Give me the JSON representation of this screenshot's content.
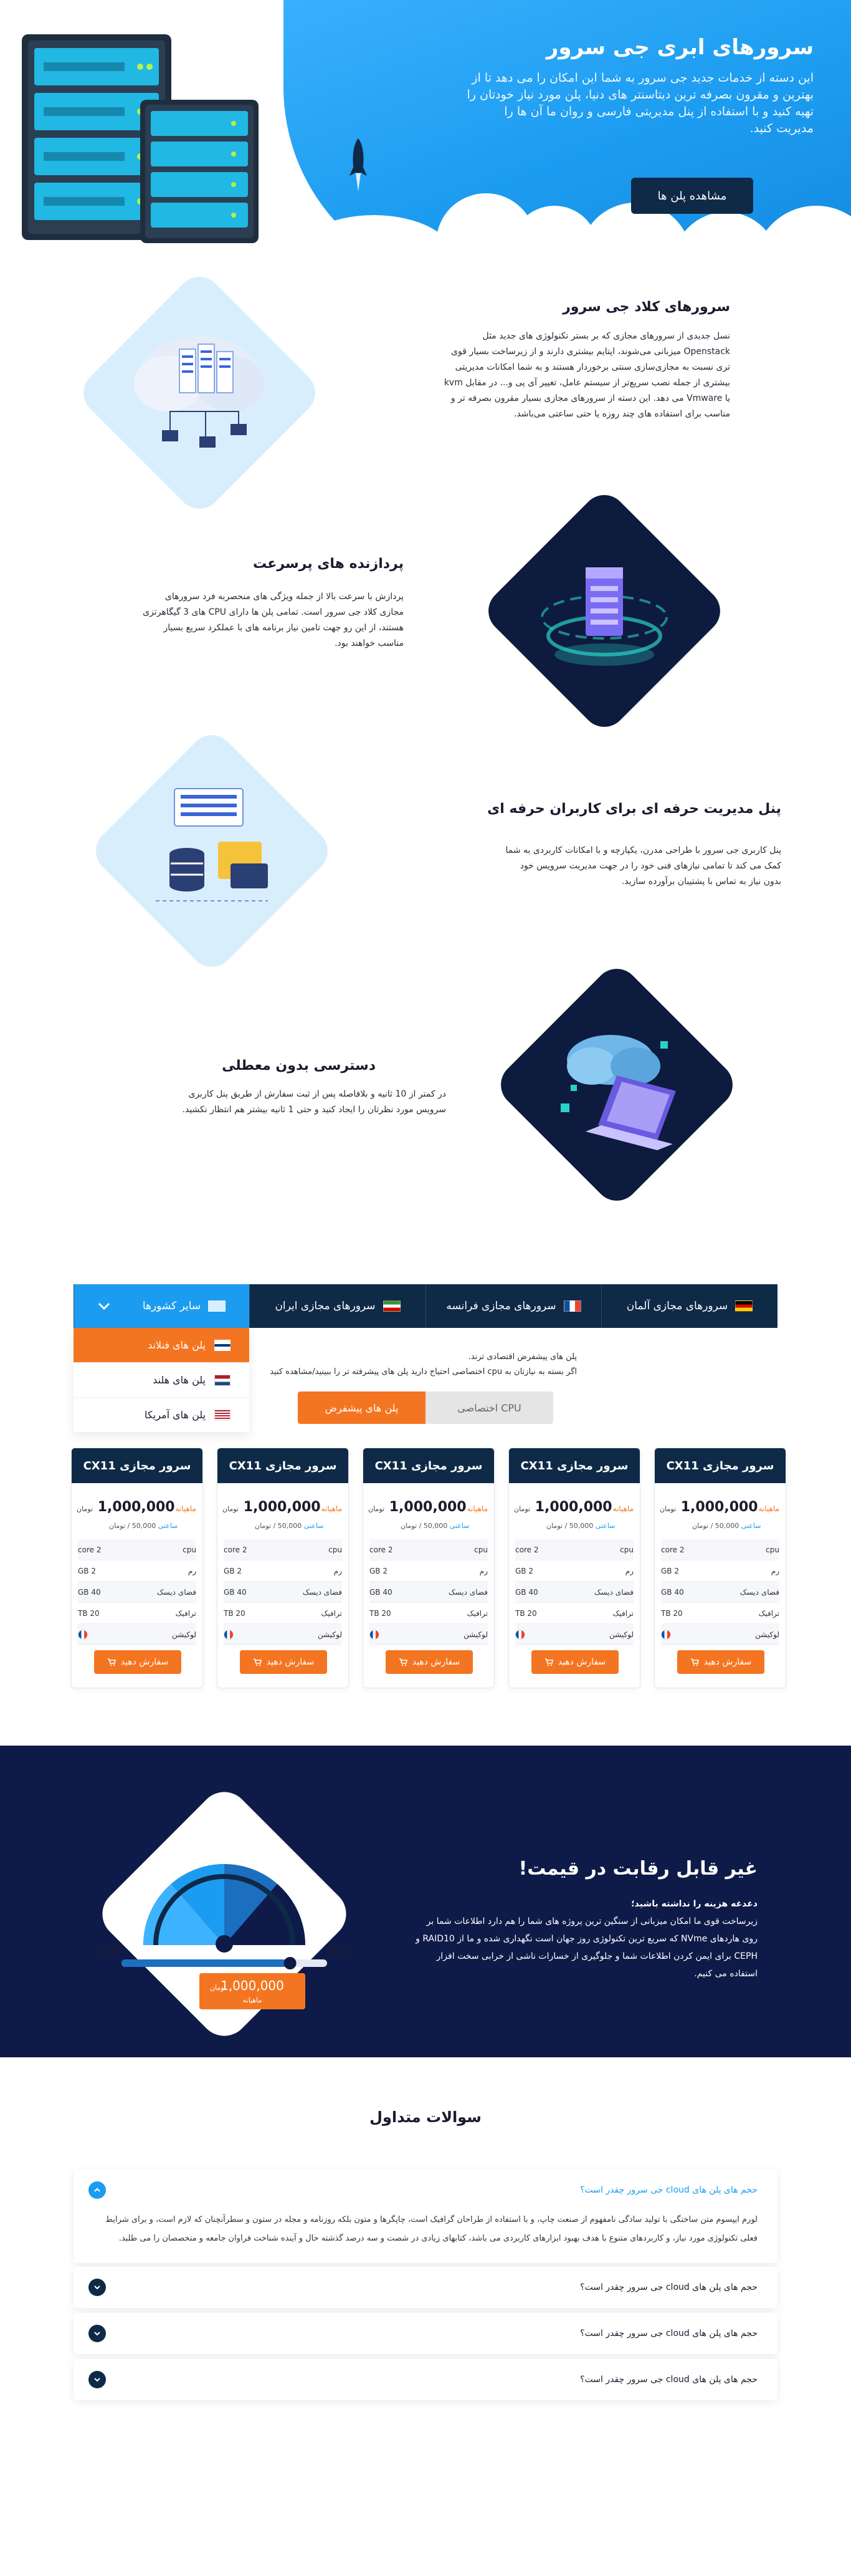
{
  "hero": {
    "title": "سرورهای ابری جی سرور",
    "description": "این دسته از خدمات جدید جی سرور به شما این امکان را می دهد تا از بهترین و مقرون بصرفه ترین دیتاسنتر های دنیا، پلن مورد نیاز خودتان را تهیه کنید و با استفاده از پنل مدیریتی فارسی و روان ما آن ها را مدیریت کنید.",
    "button_label": "مشاهده پلن ها"
  },
  "features": [
    {
      "title": "سرورهای کلاد جی سرور",
      "text": "نسل جدیدی از سرورهای مجازی که بر بستر تکنولوژی های جدید مثل Openstack میزبانی می‌شوند، اپتایم بیشتری دارند و از زیرساخت بسیار قوی تری نسبت به مجازی‌سازی سنتی برخوردار هستند و به شما امکانات مدیریتی بیشتری از جمله نصب سریع‌تر از سیستم‌ عامل، تغییر آی پی و... در مقابل kvm یا Vmware می‌ دهد. این دسته از سرورهای مجازی بسیار مقرون بصرفه تر و مناسب برای استفاده های چند روزه یا حتی ساعتی می‌باشد.",
      "icon": "cloud-server-icon"
    },
    {
      "title": "پردازنده های پرسرعت",
      "text": "پردازش با سرعت بالا از جمله ویژگی های منحصربه فرد سرورهای مجازی کلاد جی سرور است. تمامی پلن ها دارای CPU های 3 گیگاهرتزی هستند، از این رو جهت تامین نیاز برنامه های با عملکرد سریع بسیار مناسب خواهند بود.",
      "icon": "processor-icon"
    },
    {
      "title": "پنل مدیریت حرفه ای برای کاربران حرفه ای",
      "text": "پنل کاربری جی سرور با طراحی مدرن، یکپارچه و با امکانات کاربردی به شما کمک می کند تا تمامی نیازهای فنی خود را در جهت مدیریت سرویس خود بدون نیاز به تماس با پشتیبان برآورده سازید.",
      "icon": "management-panel-icon"
    },
    {
      "title": "دسترسی بدون معطلی",
      "text": "در کمتر از 10 ثانیه و بلافاصله پس از ثبت سفارش از طریق پنل کاربری سرویس مورد نظرتان را ایجاد کنید و حتی 1 ثانیه بیشتر هم انتظار نکشید.",
      "icon": "instant-access-icon"
    }
  ],
  "tabs": [
    {
      "label": "سرورهای مجازی آلمان",
      "flag": "de"
    },
    {
      "label": "سرورهای مجازی فرانسه",
      "flag": "fr"
    },
    {
      "label": "سرورهای مجازی ایران",
      "flag": "ir"
    },
    {
      "label": "سایر کشورها",
      "flag": "other"
    }
  ],
  "dropdown": [
    {
      "label": "پلن های فنلاند",
      "flag": "fi"
    },
    {
      "label": "پلن های هلند",
      "flag": "nl"
    },
    {
      "label": "پلن های آمریکا",
      "flag": "us"
    }
  ],
  "plan_desc": {
    "line1": "پلن های پیشفرض اقتصادی ترند.",
    "line2": "اگر بسته به نیازتان به cpu اختصاصی احتیاج دارید پلن های پیشرفته تر را ببینید/مشاهده کنید"
  },
  "plan_type": {
    "default_label": "پلن های پیشفرض",
    "dedicated_label": "CPU اختصاصی"
  },
  "card": {
    "title": "سرور مجازی CX11",
    "per_month": "ماهیانه /",
    "price": "1,000,000",
    "currency": "تومان",
    "daily_prefix": "ساعتی",
    "daily_price": "50,000",
    "daily_suffix": "/ تومان",
    "specs": [
      {
        "label": "cpu",
        "value": "2 core"
      },
      {
        "label": "رم",
        "value": "2 GB"
      },
      {
        "label": "فضای دیسک",
        "value": "40 GB"
      },
      {
        "label": "ترافیک",
        "value": "20 TB"
      },
      {
        "label": "لوکیشن",
        "value": "fr-flag"
      }
    ],
    "order_label": "سفارش دهید"
  },
  "price_section": {
    "title": "غیر قابل رقابت در قیمت!",
    "subtitle": "دغدغه هزینه را نداشته باشید؛",
    "text": "زیرساخت قوی ما امکان میزبانی از سنگین ترین پروژه های شما را هم دارد اطلاعات شما بر روی هاردهای NVme که سریع ترین تکنولوژی روز جهان است نگهداری شده و ما از RAID10 و CEPH برای ایمن کردن اطلاعات شما و جلوگیری از خسارات ناشی از خرابی سخت افزار استفاده می کنیم.",
    "gauge_min": "10 GB",
    "gauge_max": "10 TB",
    "gauge_price": "1,000,000",
    "gauge_currency": "تومان",
    "gauge_period": "ماهیانه",
    "gauge_level": 0.82
  },
  "faq": {
    "title": "سوالات متداول",
    "items": [
      {
        "question": "حجم های پلن های cloud جی سرور چقدر است؟",
        "answer": "لورم ایپسوم متن ساختگی با تولید سادگی نامفهوم از صنعت چاپ، و با استفاده از طراحان گرافیک است، چاپگرها و متون بلکه روزنامه و مجله در ستون و سطرآنچنان که لازم است، و برای شرایط فعلی تکنولوژی مورد نیاز، و کاربردهای متنوع با هدف بهبود ابزارهای کاربردی می باشد، کتابهای زیادی در شصت و سه درصد گذشته حال و آینده شناخت فراوان جامعه و متخصصان را می طلبد.",
        "open": true
      },
      {
        "question": "حجم های پلن های cloud جی سرور چقدر است؟"
      },
      {
        "question": "حجم های پلن های cloud جی سرور چقدر است؟"
      },
      {
        "question": "حجم های پلن های cloud جی سرور چقدر است؟"
      }
    ]
  },
  "colors": {
    "accent": "#1c9cf0",
    "navy": "#0e2a47",
    "orange": "#f47521",
    "dark_bg": "#0e1b48"
  }
}
